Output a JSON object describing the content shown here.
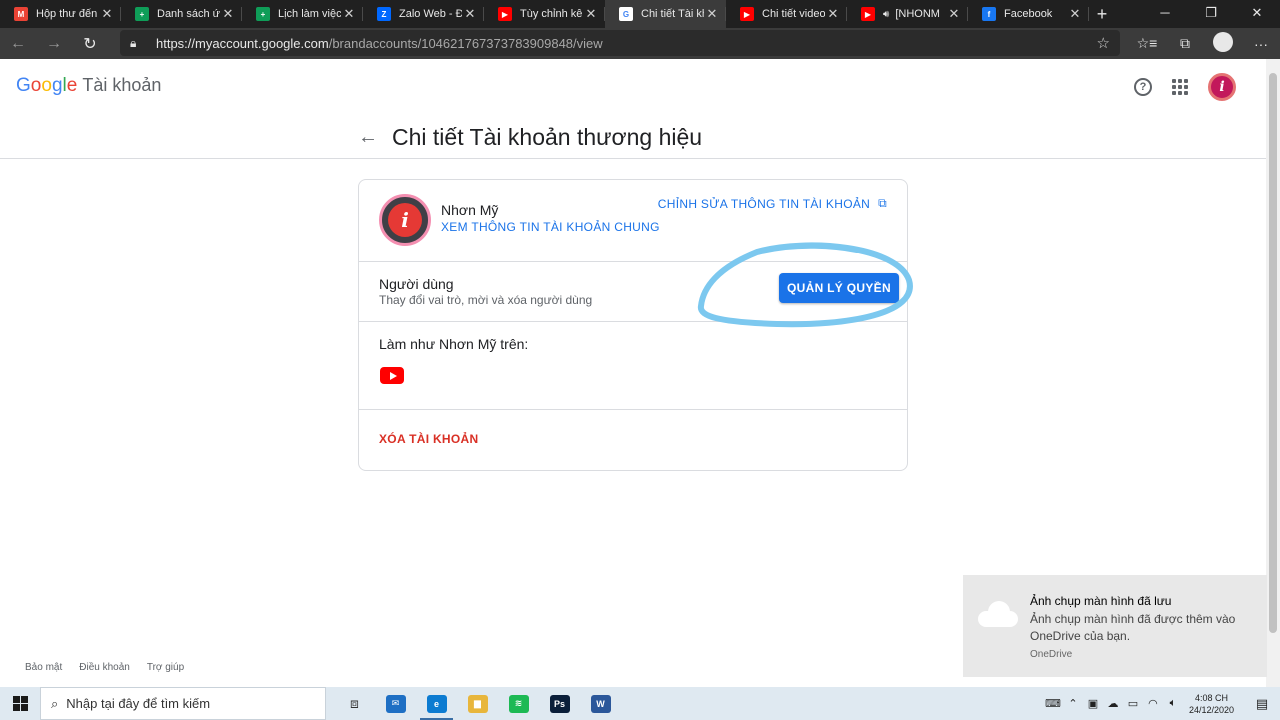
{
  "browser": {
    "tabs": [
      {
        "title": "Hộp thư đến -",
        "icon": "gmail-icon",
        "color": "#ea4335",
        "glyph": "M"
      },
      {
        "title": "Danh sách ứng",
        "icon": "sheets-icon",
        "color": "#0f9d58",
        "glyph": "+"
      },
      {
        "title": "Lịch làm việc -",
        "icon": "sheets-icon",
        "color": "#0f9d58",
        "glyph": "+"
      },
      {
        "title": "Zalo Web - Đă",
        "icon": "zalo-icon",
        "color": "#0068ff",
        "glyph": "Z"
      },
      {
        "title": "Tùy chỉnh kênh",
        "icon": "youtube-icon",
        "color": "#ff0000",
        "glyph": "▶"
      },
      {
        "title": "Chi tiết Tài kho",
        "icon": "google-icon",
        "color": "#ffffff",
        "glyph": "G",
        "active": true
      },
      {
        "title": "Chi tiết video -",
        "icon": "youtube-icon",
        "color": "#ff0000",
        "glyph": "▶"
      },
      {
        "title": "[NHONM",
        "icon": "youtube-icon",
        "color": "#ff0000",
        "glyph": "▶",
        "audio": "🔊"
      },
      {
        "title": "Facebook",
        "icon": "facebook-icon",
        "color": "#1877f2",
        "glyph": "f"
      }
    ],
    "url_host": "https://myaccount.google.com",
    "url_path": "/brandaccounts/104621767373783909848/view"
  },
  "header": {
    "logo_letters": [
      "G",
      "o",
      "o",
      "g",
      "l",
      "e"
    ],
    "product": "Tài khoản"
  },
  "page": {
    "title": "Chi tiết Tài khoản thương hiệu"
  },
  "card": {
    "account_name": "Nhơn Mỹ",
    "avatar_letter": "i",
    "view_shared_link": "XEM THÔNG TIN TÀI KHOẢN CHUNG",
    "edit_link": "CHỈNH SỬA THÔNG TIN TÀI KHOẢN",
    "users_label": "Người dùng",
    "users_desc": "Thay đổi vai trò, mời và xóa người dùng",
    "manage_button": "QUẢN LÝ QUYỀN",
    "act_as_label": "Làm như Nhơn Mỹ trên:",
    "delete_link": "XÓA TÀI KHOẢN"
  },
  "footer": {
    "links": [
      "Bảo mật",
      "Điều khoản",
      "Trợ giúp"
    ]
  },
  "toast": {
    "title": "Ảnh chụp màn hình đã lưu",
    "body": "Ảnh chụp màn hình đã được thêm vào OneDrive của bạn.",
    "source": "OneDrive"
  },
  "taskbar": {
    "search_placeholder": "Nhập tại đây để tìm kiếm",
    "apps": [
      {
        "name": "mail-icon",
        "color": "#1e6fc4",
        "glyph": "✉"
      },
      {
        "name": "edge-icon",
        "color": "#0c7bd1",
        "glyph": "e"
      },
      {
        "name": "file-explorer-icon",
        "color": "#e8b63c",
        "glyph": "▆"
      },
      {
        "name": "spotify-icon",
        "color": "#1db954",
        "glyph": "≋"
      },
      {
        "name": "photoshop-icon",
        "color": "#0b1f3a",
        "glyph": "Ps"
      },
      {
        "name": "word-icon",
        "color": "#2b579a",
        "glyph": "W"
      }
    ],
    "time": "4:08 CH",
    "date": "24/12/2020"
  },
  "colors": {
    "accent": "#1a73e8",
    "danger": "#d93025",
    "scribble": "#7cc8ef"
  }
}
